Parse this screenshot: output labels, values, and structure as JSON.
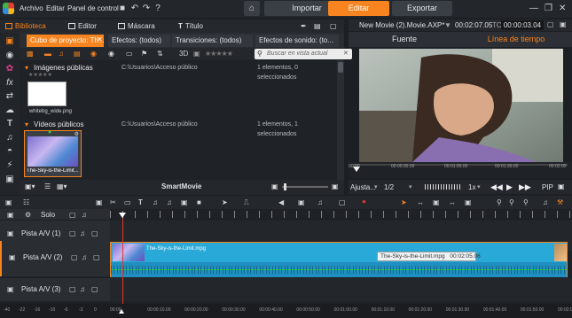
{
  "titlebar": {
    "menus": [
      "Archivo",
      "Editar",
      "Panel de control"
    ],
    "modes": [
      {
        "label": "Importar",
        "active": false
      },
      {
        "label": "Editar",
        "active": true
      },
      {
        "label": "Exportar",
        "active": false
      }
    ],
    "window_controls": [
      "minimize-icon",
      "restore-icon",
      "close-icon"
    ]
  },
  "library_tabs": [
    {
      "label": "Biblioteca",
      "active": true
    },
    {
      "label": "Editor",
      "active": false
    },
    {
      "label": "Máscara",
      "active": false
    },
    {
      "label": "Título",
      "active": false
    }
  ],
  "collection_tabs": [
    {
      "label": "Cubo de proyecto: Th...",
      "active": true
    },
    {
      "label": "Efectos: (todos)",
      "active": false
    },
    {
      "label": "Transiciones: (todos)",
      "active": false
    },
    {
      "label": "Efectos de sonido: (to...",
      "active": false
    }
  ],
  "search": {
    "placeholder": "Buscar en vista actual"
  },
  "library_groups": [
    {
      "title": "Imágenes públicas",
      "path": "C:\\Usuarios\\Acceso público",
      "count": "1 elementos, 0 seleccionados",
      "items": [
        {
          "label": "whitebg_wide.png"
        }
      ]
    },
    {
      "title": "Vídeos públicos",
      "path": "C:\\Usuarios\\Acceso público",
      "count": "1 elementos, 1 seleccionados",
      "items": [
        {
          "label": "The-Sky-is-the-Limit..."
        }
      ]
    }
  ],
  "library_bottom": {
    "label": "SmartMovie"
  },
  "preview": {
    "title": "New Movie (2).Movie.AXP*",
    "timecode_label": "TC",
    "duration": "00:02:07.05",
    "timecode": "00:00:03.04",
    "tabs": [
      {
        "label": "Fuente",
        "active": false
      },
      {
        "label": "Línea de tiempo",
        "active": true
      }
    ],
    "ruler_ticks": [
      "00:00",
      "00:00:30.00",
      "00:01:00.00",
      "00:01:30.00",
      "00:02:00"
    ],
    "fit_label": "Ajusta...",
    "ratio": "1/2",
    "speed": "1x",
    "pip_label": "PIP"
  },
  "timeline": {
    "solo_label": "Solo",
    "tracks": [
      {
        "name": "Pista A/V (1)"
      },
      {
        "name": "Pista A/V (2)"
      },
      {
        "name": "Pista A/V (3)"
      }
    ],
    "clip": {
      "label": "The-Sky-is-the-Limit.mpg",
      "tooltip_name": "The-Sky-is-the-Limit.mpg",
      "tooltip_time": "00:02:05.06"
    },
    "ruler_ticks": [
      "00:00",
      "00:00:10.00",
      "00:00:20.00",
      "00:00:30.00",
      "00:00:40.00",
      "00:00:50.00",
      "00:01:00.00",
      "00:01:10.00",
      "00:01:20.00",
      "00:01:30.00",
      "00:01:40.00",
      "00:01:50.00",
      "00:02:00.00"
    ],
    "meter_labels": [
      "-40",
      "-22",
      "-16",
      "-10",
      "-6",
      "-3",
      "0"
    ]
  },
  "colors": {
    "accent": "#f7841e",
    "clip_fill": "#29a9d8",
    "playhead": "#e0392b"
  }
}
